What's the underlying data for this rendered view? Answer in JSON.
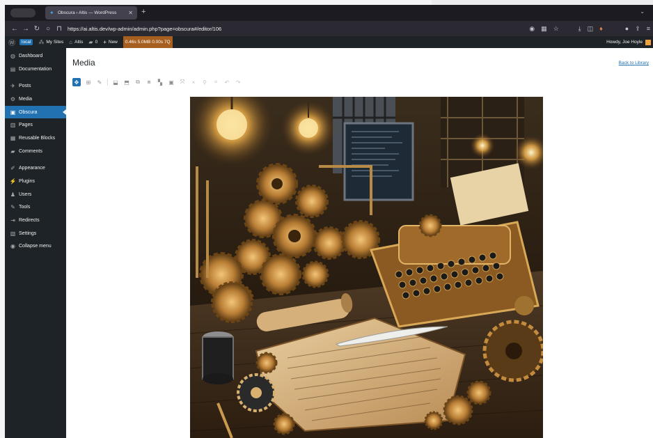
{
  "browser": {
    "tab_title": "Obscura ‹ Altis — WordPress",
    "url": "https://ai.altis.dev/wp-admin/admin.php?page=obscura#/editor/106"
  },
  "adminbar": {
    "local_label": "local",
    "my_sites": "My Sites",
    "site_name": "Altis",
    "comments_count": "0",
    "new_label": "New",
    "perf": "0.46s 5.0MB 0.00s 7Q",
    "howdy": "Howdy, Joe Hoyle"
  },
  "sidebar": {
    "items": [
      {
        "label": "Dashboard",
        "icon": "dashboard-icon"
      },
      {
        "label": "Documentation",
        "icon": "documentation-icon"
      },
      {
        "label": "Posts",
        "icon": "pin-icon"
      },
      {
        "label": "Media",
        "icon": "media-icon"
      },
      {
        "label": "Obscura",
        "icon": "camera-icon",
        "active": true
      },
      {
        "label": "Pages",
        "icon": "pages-icon"
      },
      {
        "label": "Reusable Blocks",
        "icon": "blocks-icon"
      },
      {
        "label": "Comments",
        "icon": "comment-icon"
      },
      {
        "label": "Appearance",
        "icon": "brush-icon"
      },
      {
        "label": "Plugins",
        "icon": "plug-icon"
      },
      {
        "label": "Users",
        "icon": "users-icon"
      },
      {
        "label": "Tools",
        "icon": "wrench-icon"
      },
      {
        "label": "Redirects",
        "icon": "redirect-icon"
      },
      {
        "label": "Settings",
        "icon": "settings-icon"
      },
      {
        "label": "Collapse menu",
        "icon": "collapse-icon"
      }
    ]
  },
  "main": {
    "title": "Media",
    "back_link": "Back to Library"
  },
  "colors": {
    "accent": "#2271b1",
    "adminbar": "#1d2327",
    "perf_badge": "#a65f1f"
  }
}
